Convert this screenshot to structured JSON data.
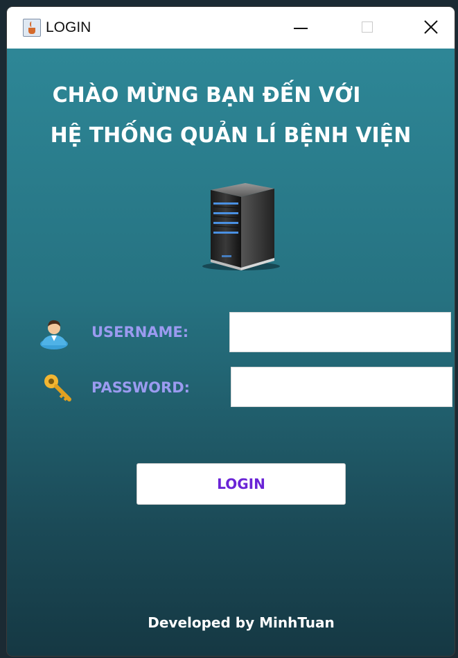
{
  "window": {
    "title": "LOGIN"
  },
  "heading": {
    "line1": "CHÀO MỪNG BẠN ĐẾN VỚI",
    "line2": "HỆ THỐNG QUẢN LÍ BỆNH VIỆN"
  },
  "icons": {
    "app": "java-cup-icon",
    "server": "server-icon",
    "username": "user-icon",
    "password": "key-icon"
  },
  "form": {
    "username_label": "USERNAME:",
    "username_value": "",
    "password_label": "PASSWORD:",
    "password_value": "",
    "login_label": "LOGIN"
  },
  "footer": {
    "text": "Developed by MinhTuan"
  },
  "colors": {
    "background_top": "#2f8a9a",
    "background_bottom": "#153843",
    "label": "#9b9bf0",
    "login_text": "#6a24d6",
    "heading": "#ffffff"
  }
}
